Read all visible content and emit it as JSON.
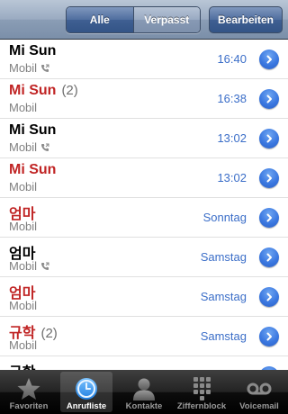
{
  "navbar": {
    "filter_all": "Alle",
    "filter_missed": "Verpasst",
    "edit": "Bearbeiten"
  },
  "calls": [
    {
      "name": "Mi Sun",
      "count": "",
      "missed": false,
      "type": "Mobil",
      "outgoing": true,
      "time": "16:40"
    },
    {
      "name": "Mi Sun",
      "count": "(2)",
      "missed": true,
      "type": "Mobil",
      "outgoing": false,
      "time": "16:38"
    },
    {
      "name": "Mi Sun",
      "count": "",
      "missed": false,
      "type": "Mobil",
      "outgoing": true,
      "time": "13:02"
    },
    {
      "name": "Mi Sun",
      "count": "",
      "missed": true,
      "type": "Mobil",
      "outgoing": false,
      "time": "13:02"
    },
    {
      "name": "엄마",
      "count": "",
      "missed": true,
      "type": "Mobil",
      "outgoing": false,
      "time": "Sonntag"
    },
    {
      "name": "엄마",
      "count": "",
      "missed": false,
      "type": "Mobil",
      "outgoing": true,
      "time": "Samstag"
    },
    {
      "name": "엄마",
      "count": "",
      "missed": true,
      "type": "Mobil",
      "outgoing": false,
      "time": "Samstag"
    },
    {
      "name": "규학",
      "count": "(2)",
      "missed": true,
      "type": "Mobil",
      "outgoing": false,
      "time": "Samstag"
    },
    {
      "name": "규학",
      "count": "",
      "missed": false,
      "type": "",
      "outgoing": false,
      "time": ""
    }
  ],
  "tabbar": {
    "favorites": "Favoriten",
    "recents": "Anrufliste",
    "contacts": "Kontakte",
    "keypad": "Ziffernblock",
    "voicemail": "Voicemail"
  },
  "colors": {
    "missed": "#c02424",
    "time": "#3b6ec8",
    "accent": "#3b78e0"
  }
}
